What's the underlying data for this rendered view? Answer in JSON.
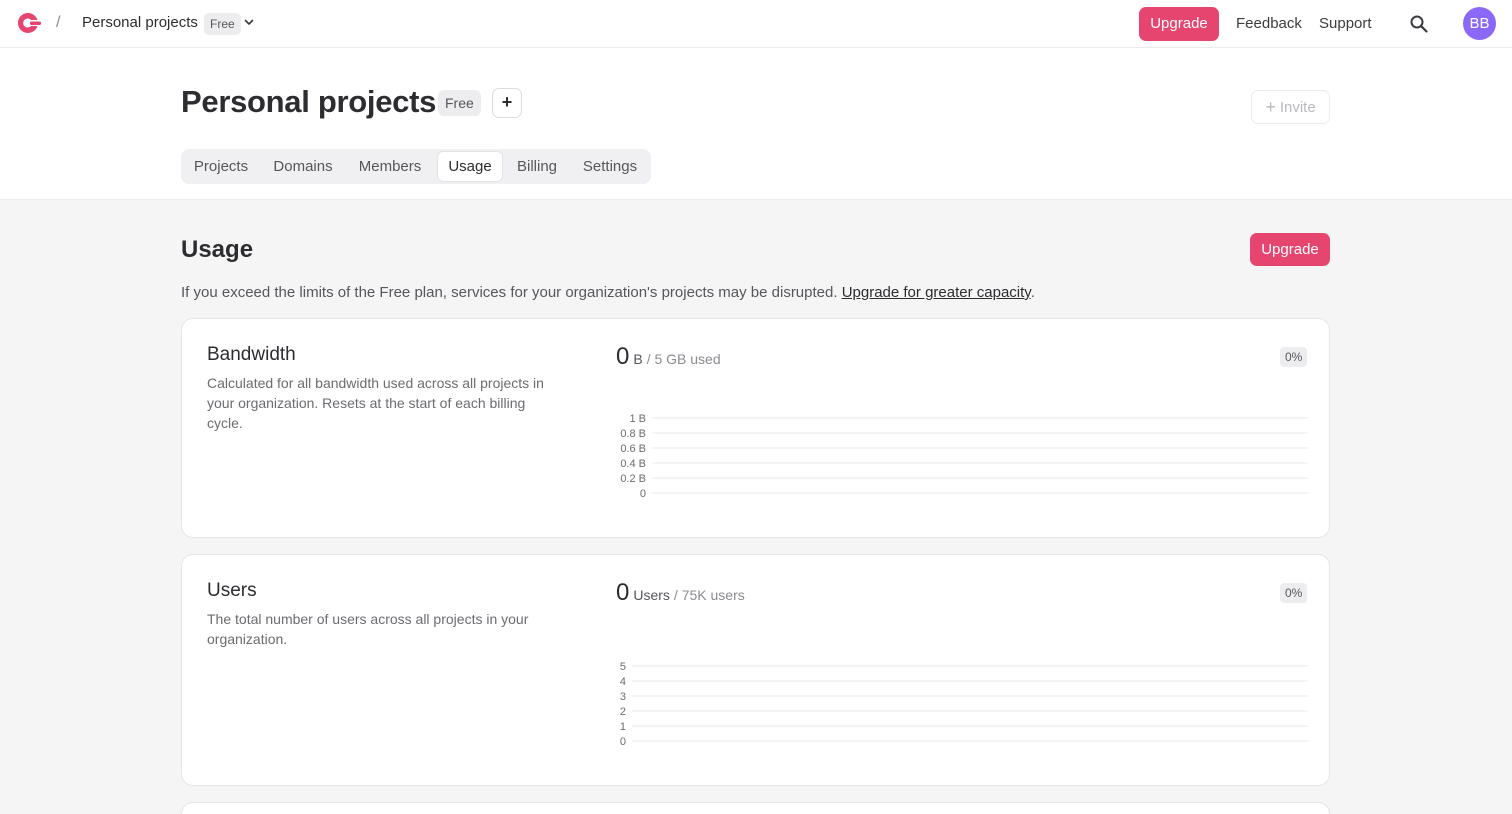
{
  "topbar": {
    "breadcrumb_separator": "/",
    "org_name": "Personal projects",
    "org_plan_badge": "Free",
    "upgrade_label": "Upgrade",
    "feedback_label": "Feedback",
    "support_label": "Support",
    "avatar_initials": "BB",
    "brand_color": "#e5456e",
    "avatar_color": "#8b68f7"
  },
  "header": {
    "title": "Personal projects",
    "plan_badge": "Free",
    "add_label": "+",
    "invite_label": "Invite",
    "tabs": [
      {
        "label": "Projects",
        "active": false
      },
      {
        "label": "Domains",
        "active": false
      },
      {
        "label": "Members",
        "active": false
      },
      {
        "label": "Usage",
        "active": true
      },
      {
        "label": "Billing",
        "active": false
      },
      {
        "label": "Settings",
        "active": false
      }
    ]
  },
  "usage": {
    "title": "Usage",
    "upgrade_label": "Upgrade",
    "notice_text": "If you exceed the limits of the Free plan, services for your organization's projects may be disrupted. ",
    "notice_link": "Upgrade for greater capacity",
    "notice_end": ".",
    "cards": [
      {
        "title": "Bandwidth",
        "description": "Calculated for all bandwidth used across all projects in your organization. Resets at the start of each billing cycle.",
        "value": "0",
        "unit": "B",
        "limit": "/ 5 GB used",
        "percent": "0%",
        "y_ticks": [
          "1 B",
          "0.8 B",
          "0.6 B",
          "0.4 B",
          "0.2 B",
          "0"
        ]
      },
      {
        "title": "Users",
        "description": "The total number of users across all projects in your organization.",
        "value": "0",
        "unit": "Users",
        "limit": "/ 75K users",
        "percent": "0%",
        "y_ticks": [
          "5",
          "4",
          "3",
          "2",
          "1",
          "0"
        ]
      }
    ]
  }
}
